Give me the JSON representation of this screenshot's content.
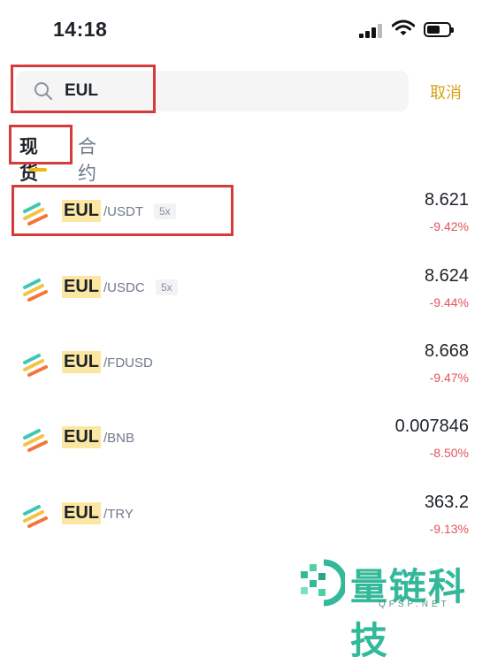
{
  "status_bar": {
    "time": "14:18"
  },
  "search": {
    "query": "EUL",
    "cancel_label": "取消"
  },
  "tabs": [
    {
      "label": "现货",
      "active": true
    },
    {
      "label": "合约",
      "active": false
    }
  ],
  "pairs": [
    {
      "base": "EUL",
      "quote": "/USDT",
      "leverage": "5x",
      "price": "8.621",
      "change": "-9.42%"
    },
    {
      "base": "EUL",
      "quote": "/USDC",
      "leverage": "5x",
      "price": "8.624",
      "change": "-9.44%"
    },
    {
      "base": "EUL",
      "quote": "/FDUSD",
      "leverage": "",
      "price": "8.668",
      "change": "-9.47%"
    },
    {
      "base": "EUL",
      "quote": "/BNB",
      "leverage": "",
      "price": "0.007846",
      "change": "-8.50%"
    },
    {
      "base": "EUL",
      "quote": "/TRY",
      "leverage": "",
      "price": "363.2",
      "change": "-9.13%"
    }
  ],
  "watermark": {
    "title": "量链科技",
    "subtitle": "QFSP.NET"
  },
  "colors": {
    "accent": "#f0b90b",
    "negative": "#e5535c",
    "highlight": "#d63a3a",
    "watermark": "#33b89a"
  }
}
